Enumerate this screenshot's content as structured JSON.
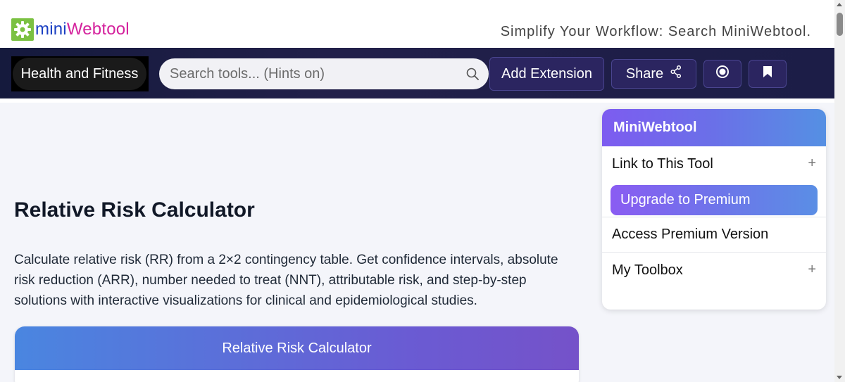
{
  "header": {
    "logo_mini": "mini",
    "logo_webtool": "Webtool",
    "tagline": "Simplify Your Workflow: Search MiniWebtool."
  },
  "nav": {
    "category": "Health and Fitness",
    "search_placeholder": "Search tools... (Hints on)",
    "add_extension": "Add Extension",
    "share": "Share"
  },
  "main": {
    "title": "Relative Risk Calculator",
    "description": "Calculate relative risk (RR) from a 2×2 contingency table. Get confidence intervals, absolute risk reduction (ARR), number needed to treat (NNT), attributable risk, and step-by-step solutions with interactive visualizations for clinical and epidemiological studies.",
    "calc_header": "Relative Risk Calculator"
  },
  "panel": {
    "title": "MiniWebtool",
    "link_tool": "Link to This Tool",
    "upgrade": "Upgrade to Premium",
    "premium": "Access Premium Version",
    "toolbox": "My Toolbox",
    "plus": "+"
  },
  "colors": {
    "nav_bg": "#1c1d47",
    "logo_green": "#7bc142",
    "logo_blue": "#1a3fc2",
    "logo_pink": "#d4229d",
    "accent_purple": "#7d5cf0",
    "accent_blue": "#5590e3"
  },
  "icons": [
    "gear-icon",
    "search-icon",
    "share-icon",
    "record-icon",
    "bookmark-icon",
    "plus-icon"
  ]
}
